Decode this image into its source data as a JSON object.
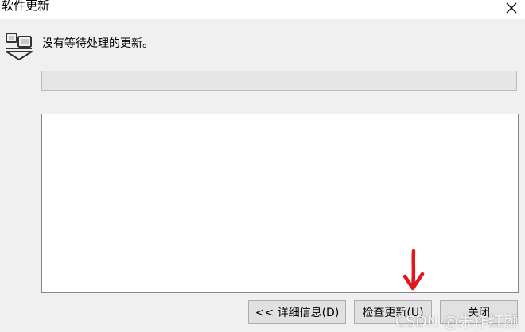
{
  "window": {
    "title": "软件更新"
  },
  "status": {
    "message": "没有等待处理的更新。"
  },
  "progress": {
    "value": 0
  },
  "buttons": {
    "details": "<< 详细信息(D)",
    "check": "检查更新(U)",
    "close": "关闭"
  },
  "watermark": "CSDN @朱祚红颜",
  "icons": {
    "app": "software-update-icon",
    "close": "close-icon",
    "annotation": "red-arrow"
  },
  "colors": {
    "annotation": "#e3161d",
    "progress_fill": "#06b025"
  }
}
